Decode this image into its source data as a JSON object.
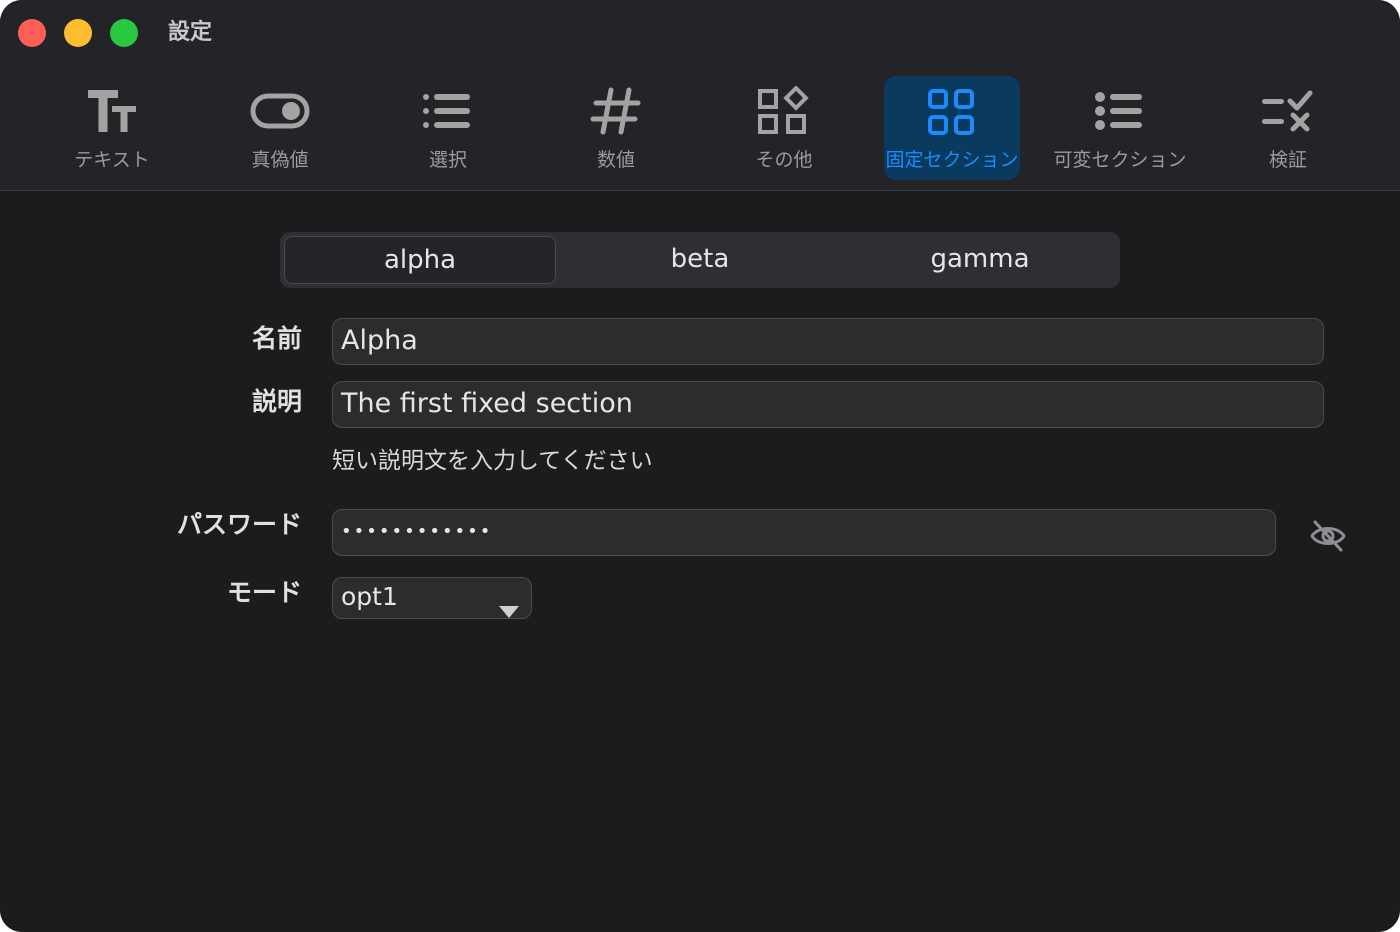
{
  "window": {
    "title": "設定"
  },
  "toolbar": {
    "items": [
      {
        "label": "テキスト",
        "icon": "text-format-icon"
      },
      {
        "label": "真偽値",
        "icon": "toggle-icon"
      },
      {
        "label": "選択",
        "icon": "list-icon"
      },
      {
        "label": "数値",
        "icon": "hash-icon"
      },
      {
        "label": "その他",
        "icon": "shapes-icon"
      },
      {
        "label": "固定セクション",
        "icon": "grid-icon",
        "active": true
      },
      {
        "label": "可変セクション",
        "icon": "bullet-list-icon"
      },
      {
        "label": "検証",
        "icon": "validate-icon"
      }
    ]
  },
  "tabs": [
    {
      "label": "alpha",
      "selected": true
    },
    {
      "label": "beta"
    },
    {
      "label": "gamma"
    }
  ],
  "form": {
    "name_label": "名前",
    "name_value": "Alpha",
    "desc_label": "説明",
    "desc_value": "The first fixed section",
    "desc_hint": "短い説明文を入力してください",
    "password_label": "パスワード",
    "password_value": "••••••••••••",
    "mode_label": "モード",
    "mode_value": "opt1"
  },
  "colors": {
    "accent": "#1a8cff",
    "active_bg": "#0a3a5e",
    "background": "#1c1c1e"
  }
}
